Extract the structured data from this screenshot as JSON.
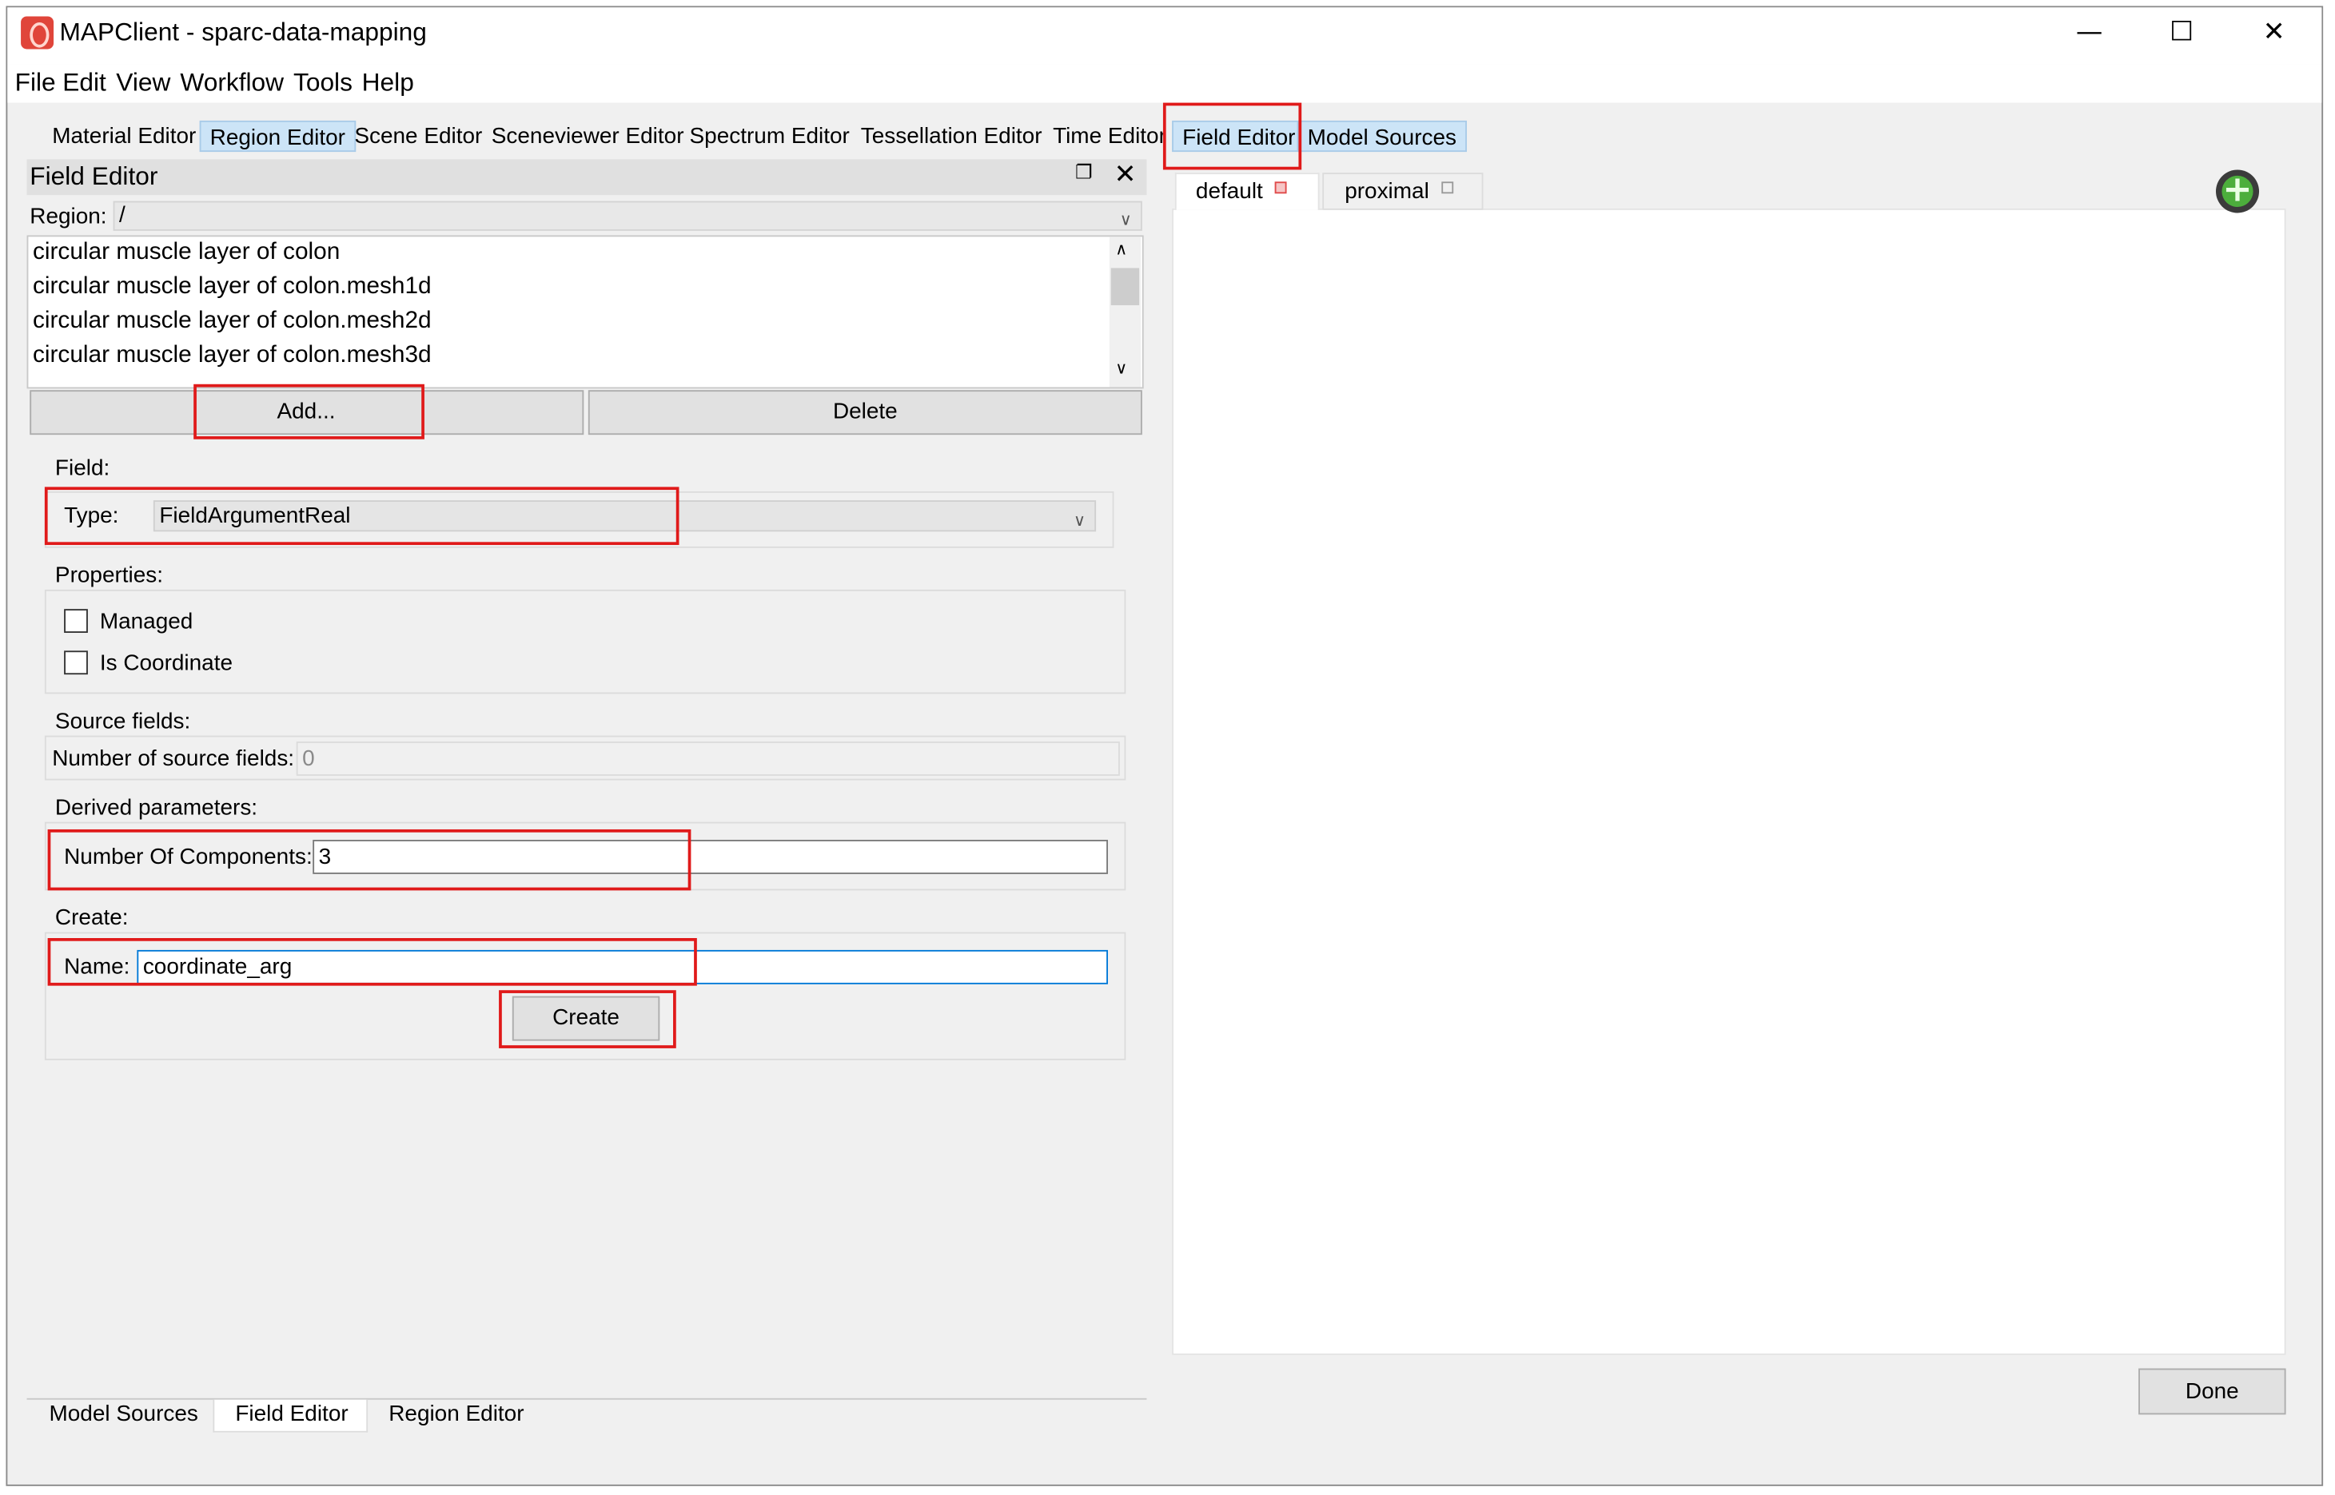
{
  "window": {
    "title": "MAPClient - sparc-data-mapping",
    "minimize_glyph": "—",
    "maximize_glyph": "☐",
    "close_glyph": "✕"
  },
  "menu": [
    "File",
    "Edit",
    "View",
    "Workflow",
    "Tools",
    "Help"
  ],
  "top_tabs": [
    "Material Editor",
    "Region Editor",
    "Scene Editor",
    "Sceneviewer Editor",
    "Spectrum Editor",
    "Tessellation Editor",
    "Time Editor",
    "Field Editor",
    "Model Sources"
  ],
  "dock": {
    "title": "Field Editor",
    "region_label": "Region:",
    "region_value": "/",
    "field_list": [
      "circular muscle layer of colon",
      "circular muscle layer of colon.mesh1d",
      "circular muscle layer of colon.mesh2d",
      "circular muscle layer of colon.mesh3d"
    ],
    "add_label": "Add...",
    "delete_label": "Delete",
    "field_group_label": "Field:",
    "type_label": "Type:",
    "type_value": "FieldArgumentReal",
    "properties_label": "Properties:",
    "managed_label": "Managed",
    "managed_checked": false,
    "coordinate_label": "Is Coordinate",
    "coordinate_checked": false,
    "source_label": "Source fields:",
    "source_count_label": "Number of source fields:",
    "source_count_value": "0",
    "derived_label": "Derived parameters:",
    "components_label": "Number Of Components:",
    "components_value": "3",
    "create_group_label": "Create:",
    "name_label": "Name:",
    "name_value": "coordinate_arg",
    "create_label": "Create"
  },
  "bottom_tabs": [
    "Model Sources",
    "Field Editor",
    "Region Editor"
  ],
  "scene_tabs": [
    "default",
    "proximal"
  ],
  "done_label": "Done",
  "colors": {
    "highlight": "#e01a1a",
    "selected_tab": "#cce4f7",
    "input_focus": "#0078d7"
  }
}
